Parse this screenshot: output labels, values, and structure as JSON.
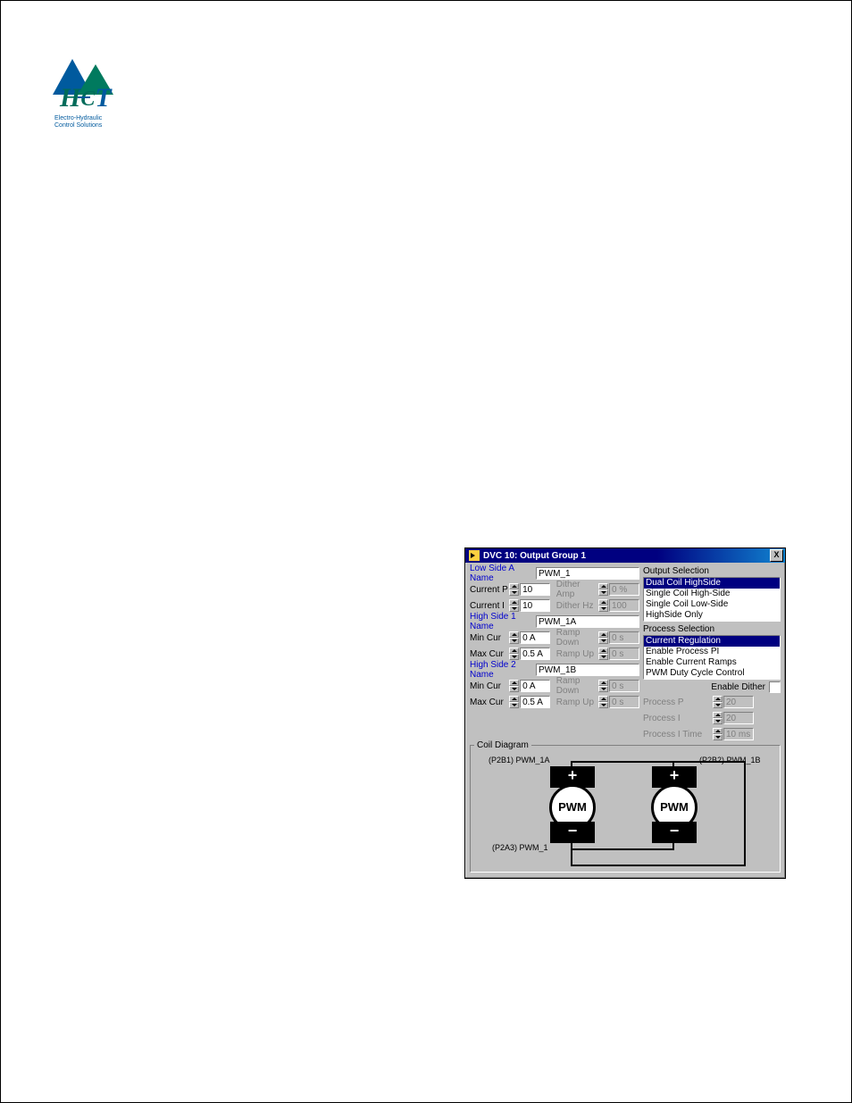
{
  "logo": {
    "tagline_line1": "Electro-Hydraulic",
    "tagline_line2": "Control Solutions"
  },
  "dialog": {
    "title": "DVC 10: Output Group 1",
    "close": "X",
    "left": {
      "lowSideA": {
        "label": "Low Side A Name",
        "value": "PWM_1"
      },
      "currentP": {
        "label": "Current P",
        "value": "10"
      },
      "currentI": {
        "label": "Current I",
        "value": "10"
      },
      "ditherAmp": {
        "label": "Dither Amp",
        "value": "0 %"
      },
      "ditherHz": {
        "label": "Dither Hz",
        "value": "100"
      },
      "highSide1": {
        "label": "High Side 1 Name",
        "value": "PWM_1A"
      },
      "hs1_min": {
        "label": "Min Cur",
        "value": "0 A"
      },
      "hs1_max": {
        "label": "Max Cur",
        "value": "0.5 A"
      },
      "hs1_rampDown": {
        "label": "Ramp Down",
        "value": "0 s"
      },
      "hs1_rampUp": {
        "label": "Ramp Up",
        "value": "0 s"
      },
      "highSide2": {
        "label": "High Side 2 Name",
        "value": "PWM_1B"
      },
      "hs2_min": {
        "label": "Min Cur",
        "value": "0 A"
      },
      "hs2_max": {
        "label": "Max Cur",
        "value": "0.5 A"
      },
      "hs2_rampDown": {
        "label": "Ramp Down",
        "value": "0 s"
      },
      "hs2_rampUp": {
        "label": "Ramp Up",
        "value": "0 s"
      }
    },
    "right": {
      "outputSelection": {
        "label": "Output Selection",
        "options": [
          "Dual Coil HighSide",
          "Single Coil High-Side",
          "Single Coil Low-Side",
          "HighSide Only"
        ],
        "selectedIndex": 0
      },
      "processSelection": {
        "label": "Process Selection",
        "options": [
          "Current Regulation",
          "Enable Process PI",
          "Enable Current Ramps",
          "PWM Duty Cycle Control"
        ],
        "selectedIndex": 0
      },
      "enableDither": {
        "label": "Enable Dither"
      },
      "processP": {
        "label": "Process P",
        "value": "20"
      },
      "processI": {
        "label": "Process I",
        "value": "20"
      },
      "processITime": {
        "label": "Process I Time",
        "value": "10 ms"
      }
    },
    "coilDiagram": {
      "legend": "Coil Diagram",
      "labelA": "(P2B1) PWM_1A",
      "labelB": "(P2B2) PWM_1B",
      "labelBottom": "(P2A3) PWM_1",
      "pwm": "PWM"
    }
  }
}
